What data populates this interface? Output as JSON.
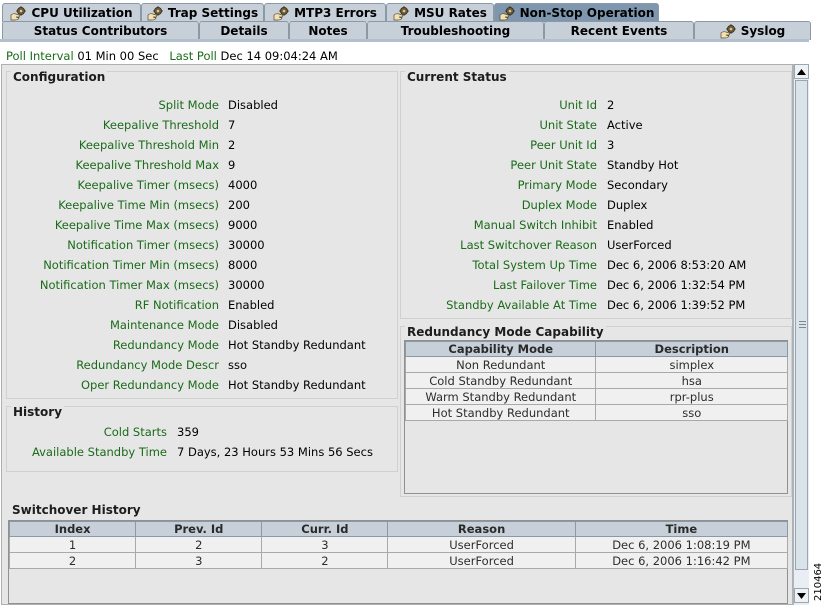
{
  "tabs_row1": [
    {
      "label": "CPU Utilization",
      "icon": "gear-hand-icon",
      "active": false
    },
    {
      "label": "Trap Settings",
      "icon": "gear-hand-icon",
      "active": false
    },
    {
      "label": "MTP3 Errors",
      "icon": "gear-hand-icon",
      "active": false
    },
    {
      "label": "MSU Rates",
      "icon": "gear-hand-icon",
      "active": false
    },
    {
      "label": "Non-Stop Operation",
      "icon": "gear-hand-icon",
      "active": true
    }
  ],
  "tabs_row2": [
    {
      "label": "Status Contributors"
    },
    {
      "label": "Details"
    },
    {
      "label": "Notes"
    },
    {
      "label": "Troubleshooting"
    },
    {
      "label": "Recent Events"
    },
    {
      "label": "Syslog",
      "icon": "gear-hand-icon"
    }
  ],
  "poll": {
    "interval_label": "Poll Interval",
    "interval_value": "01 Min 00 Sec",
    "last_label": "Last Poll",
    "last_value": "Dec 14  09:04:24 AM"
  },
  "configuration": {
    "title": "Configuration",
    "rows": [
      {
        "k": "Split Mode",
        "v": "Disabled"
      },
      {
        "k": "Keepalive Threshold",
        "v": "7"
      },
      {
        "k": "Keepalive Threshold Min",
        "v": "2"
      },
      {
        "k": "Keepalive Threshold Max",
        "v": "9"
      },
      {
        "k": "Keepalive Timer (msecs)",
        "v": "4000"
      },
      {
        "k": "Keepalive Time Min (msecs)",
        "v": "200"
      },
      {
        "k": "Keepalive Time Max (msecs)",
        "v": "9000"
      },
      {
        "k": "Notification Timer (msecs)",
        "v": "30000"
      },
      {
        "k": "Notification Timer Min (msecs)",
        "v": "8000"
      },
      {
        "k": "Notification Timer Max (msecs)",
        "v": "30000"
      },
      {
        "k": "RF Notification",
        "v": "Enabled"
      },
      {
        "k": "Maintenance Mode",
        "v": "Disabled"
      },
      {
        "k": "Redundancy Mode",
        "v": "Hot Standby Redundant"
      },
      {
        "k": "Redundancy Mode Descr",
        "v": "sso"
      },
      {
        "k": "Oper Redundancy Mode",
        "v": "Hot Standby Redundant"
      }
    ]
  },
  "current_status": {
    "title": "Current Status",
    "rows": [
      {
        "k": "Unit Id",
        "v": "2"
      },
      {
        "k": "Unit State",
        "v": "Active"
      },
      {
        "k": "Peer Unit Id",
        "v": "3"
      },
      {
        "k": "Peer Unit State",
        "v": "Standby Hot"
      },
      {
        "k": "Primary Mode",
        "v": "Secondary"
      },
      {
        "k": "Duplex Mode",
        "v": "Duplex"
      },
      {
        "k": "Manual Switch Inhibit",
        "v": "Enabled"
      },
      {
        "k": "Last Switchover Reason",
        "v": "UserForced"
      },
      {
        "k": "Total System Up Time",
        "v": "Dec 6, 2006 8:53:20 AM"
      },
      {
        "k": "Last Failover Time",
        "v": "Dec 6, 2006 1:32:54 PM"
      },
      {
        "k": "Standby Available At Time",
        "v": "Dec 6, 2006 1:39:52 PM"
      }
    ]
  },
  "history": {
    "title": "History",
    "rows": [
      {
        "k": "Cold Starts",
        "v": "359"
      },
      {
        "k": "Available Standby Time",
        "v": "7 Days, 23 Hours 53 Mins 56 Secs"
      }
    ]
  },
  "redundancy_capability": {
    "title": "Redundancy Mode Capability",
    "columns": [
      "Capability Mode",
      "Description"
    ],
    "rows": [
      [
        "Non Redundant",
        "simplex"
      ],
      [
        "Cold Standby Redundant",
        "hsa"
      ],
      [
        "Warm Standby Redundant",
        "rpr-plus"
      ],
      [
        "Hot Standby Redundant",
        "sso"
      ]
    ]
  },
  "switchover_history": {
    "title": "Switchover History",
    "columns": [
      "Index",
      "Prev. Id",
      "Curr. Id",
      "Reason",
      "Time"
    ],
    "rows": [
      [
        "1",
        "2",
        "3",
        "UserForced",
        "Dec 6, 2006 1:08:19 PM"
      ],
      [
        "2",
        "3",
        "2",
        "UserForced",
        "Dec 6, 2006 1:16:42 PM"
      ]
    ]
  },
  "side_number": "210464",
  "colors": {
    "label_green": "#1a6b1a",
    "tab_bg": "#c7d0d8",
    "tab_active": "#7e97ae",
    "panel_bg": "#e6e6e6"
  }
}
